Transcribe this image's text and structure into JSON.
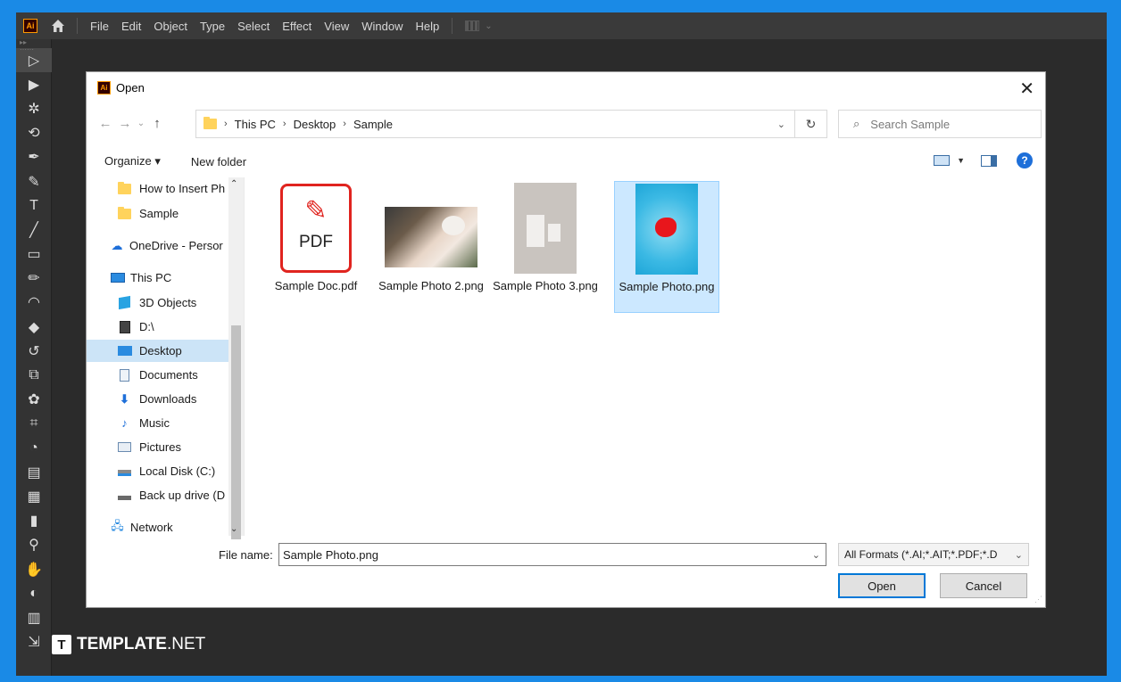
{
  "app": {
    "logo_text": "Ai",
    "menu": [
      "File",
      "Edit",
      "Object",
      "Type",
      "Select",
      "Effect",
      "View",
      "Window",
      "Help"
    ]
  },
  "tools": [
    "▷",
    "▶",
    "✲",
    "⟲",
    "✒",
    "✎",
    "T",
    "╱",
    "▭",
    "✏",
    "◠",
    "◆",
    "↺",
    "⧉",
    "✿",
    "⌗",
    "◔",
    "▤",
    "▦",
    "▮",
    "⚲",
    "✋",
    "◐",
    "▥",
    "⇲"
  ],
  "dialog": {
    "title": "Open",
    "breadcrumb": [
      "This PC",
      "Desktop",
      "Sample"
    ],
    "search_placeholder": "Search Sample",
    "organize_label": "Organize ▾",
    "new_folder_label": "New folder",
    "nav_items": [
      {
        "label": "How to Insert Ph",
        "icon": "folder-icon"
      },
      {
        "label": "Sample",
        "icon": "folder-icon"
      },
      {
        "label": "OneDrive - Persor",
        "icon": "cloud-icon"
      },
      {
        "label": "This PC",
        "icon": "computer-icon"
      },
      {
        "label": "3D Objects",
        "icon": "cube-icon"
      },
      {
        "label": "D:\\",
        "icon": "drive-icon"
      },
      {
        "label": "Desktop",
        "icon": "desktop-icon"
      },
      {
        "label": "Documents",
        "icon": "document-icon"
      },
      {
        "label": "Downloads",
        "icon": "download-icon"
      },
      {
        "label": "Music",
        "icon": "music-icon"
      },
      {
        "label": "Pictures",
        "icon": "pictures-icon"
      },
      {
        "label": "Local Disk (C:)",
        "icon": "disk-icon"
      },
      {
        "label": "Back up drive (D",
        "icon": "drive-icon"
      },
      {
        "label": "Network",
        "icon": "network-icon"
      }
    ],
    "files": [
      {
        "name": "Sample Doc.pdf",
        "pdf_label": "PDF"
      },
      {
        "name": "Sample Photo 2.png"
      },
      {
        "name": "Sample Photo 3.png"
      },
      {
        "name": "Sample Photo.png",
        "selected": true
      }
    ],
    "file_name_label": "File name:",
    "file_name_value": "Sample Photo.png",
    "filter_value": "All Formats (*.AI;*.AIT;*.PDF;*.D",
    "open_label": "Open",
    "cancel_label": "Cancel"
  },
  "watermark": {
    "letter": "T",
    "brand_bold": "TEMPLATE",
    "brand_rest": ".NET"
  },
  "colors": {
    "accent": "#0078d7",
    "selection": "#cce8ff",
    "frame": "#1a8ae6",
    "ai_orange": "#ff9a00"
  }
}
